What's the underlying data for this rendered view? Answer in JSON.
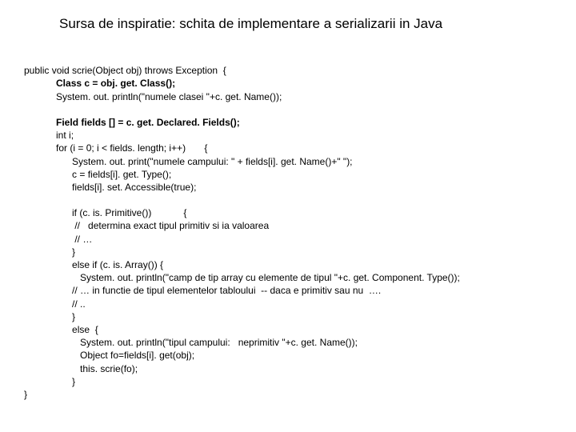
{
  "title": "Sursa de inspiratie: schita de implementare a serializarii in Java",
  "code": {
    "l1": "public void scrie(Object obj) throws Exception  {",
    "l2": "Class c = obj. get. Class();",
    "l3": "System. out. println(\"numele clasei \"+c. get. Name());",
    "l4": "Field fields [] = c. get. Declared. Fields();",
    "l5": "int i;",
    "l6": "for (i = 0; i < fields. length; i++)       {",
    "l7": "System. out. print(\"numele campului: \" + fields[i]. get. Name()+\" \");",
    "l8": "c = fields[i]. get. Type();",
    "l9": "fields[i]. set. Accessible(true);",
    "l10": "if (c. is. Primitive())            {",
    "l11": " //   determina exact tipul primitiv si ia valoarea",
    "l12": " // …",
    "l13": "}",
    "l14": "else if (c. is. Array()) {",
    "l15": "   System. out. println(\"camp de tip array cu elemente de tipul \"+c. get. Component. Type());",
    "l16": "// … in functie de tipul elementelor tabloului  -- daca e primitiv sau nu  ….",
    "l17": "// ..",
    "l18": "}",
    "l19": "else  {",
    "l20": "System. out. println(\"tipul campului:   neprimitiv \"+c. get. Name());",
    "l21": "Object fo=fields[i]. get(obj);",
    "l22": "this. scrie(fo);",
    "l23": "}",
    "l24": "}"
  }
}
